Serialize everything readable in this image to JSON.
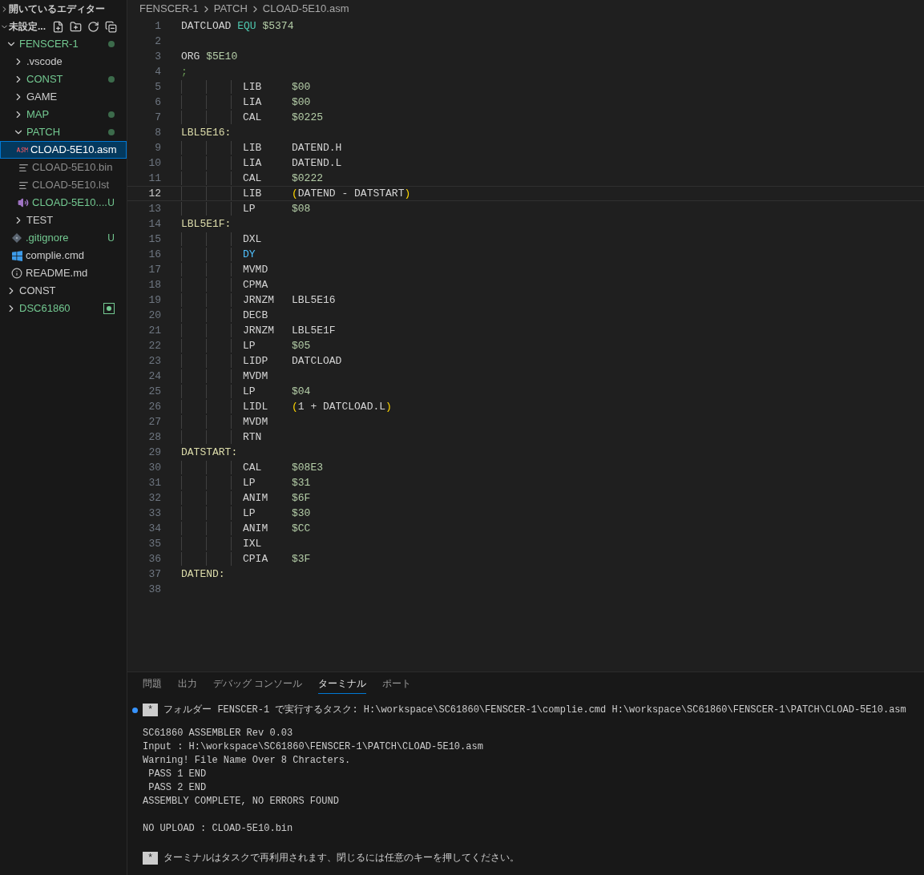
{
  "sidebar": {
    "sections": [
      {
        "title": "開いているエディター",
        "expanded": false
      },
      {
        "title": "未設定...",
        "expanded": true,
        "tree": [
          {
            "label": "FENSCER-1",
            "kind": "folder",
            "expanded": true,
            "selected": false,
            "color": "#73c991",
            "modified": true,
            "children": [
              {
                "label": ".vscode",
                "kind": "folder",
                "expanded": false,
                "selected": false,
                "color": "#cccccc",
                "modified": false
              },
              {
                "label": "CONST",
                "kind": "folder",
                "expanded": false,
                "selected": false,
                "color": "#73c991",
                "modified": true
              },
              {
                "label": "GAME",
                "kind": "folder",
                "expanded": false,
                "selected": false,
                "color": "#cccccc",
                "modified": false
              },
              {
                "label": "MAP",
                "kind": "folder",
                "expanded": false,
                "selected": false,
                "color": "#73c991",
                "modified": true
              },
              {
                "label": "PATCH",
                "kind": "folder",
                "expanded": true,
                "selected": false,
                "color": "#73c991",
                "modified": true,
                "children": [
                  {
                    "label": "CLOAD-5E10.asm",
                    "kind": "asm-file",
                    "selected": true
                  },
                  {
                    "label": "CLOAD-5E10.bin",
                    "kind": "text-file",
                    "selected": false,
                    "color": "#8c8c8c"
                  },
                  {
                    "label": "CLOAD-5E10.lst",
                    "kind": "text-file",
                    "selected": false,
                    "color": "#8c8c8c"
                  },
                  {
                    "label": "CLOAD-5E10....",
                    "kind": "audio-file",
                    "selected": false,
                    "color": "#73c991",
                    "status": "U"
                  }
                ]
              },
              {
                "label": "TEST",
                "kind": "folder",
                "expanded": false,
                "selected": false,
                "color": "#cccccc",
                "modified": false
              },
              {
                "label": ".gitignore",
                "kind": "git-file",
                "selected": false,
                "color": "#73c991",
                "status": "U"
              },
              {
                "label": "complie.cmd",
                "kind": "windows-file",
                "selected": false,
                "color": "#cccccc"
              },
              {
                "label": "README.md",
                "kind": "info-file",
                "selected": false,
                "color": "#cccccc"
              }
            ]
          },
          {
            "label": "CONST",
            "kind": "folder",
            "expanded": false,
            "selected": false,
            "color": "#cccccc",
            "modified": false
          },
          {
            "label": "DSC61860",
            "kind": "repo-folder",
            "expanded": false,
            "selected": false,
            "color": "#73c991",
            "modified": true
          }
        ]
      }
    ]
  },
  "breadcrumbs": [
    "FENSCER-1",
    "PATCH",
    "CLOAD-5E10.asm"
  ],
  "editor": {
    "lines": [
      {
        "n": "1",
        "kind": "plain",
        "current": false,
        "tokens": [
          {
            "text": "DATCLOAD",
            "kind": "plain"
          },
          {
            "text": "EQU",
            "kind": "keyword"
          },
          {
            "text": "$5374",
            "kind": "number"
          }
        ]
      },
      {
        "n": "2",
        "kind": "empty",
        "current": false
      },
      {
        "n": "3",
        "kind": "plain",
        "current": false,
        "tokens": [
          {
            "text": "ORG",
            "kind": "plain"
          },
          {
            "text": "$5E10",
            "kind": "number"
          }
        ]
      },
      {
        "n": "4",
        "kind": "plain",
        "current": false,
        "tokens": [
          {
            "text": ";",
            "kind": "comment"
          }
        ]
      },
      {
        "n": "5",
        "kind": "instruction",
        "current": false,
        "op": {
          "text": "LIB",
          "kind": "plain"
        },
        "operand": [
          {
            "text": "$00",
            "kind": "number"
          }
        ]
      },
      {
        "n": "6",
        "kind": "instruction",
        "current": false,
        "op": {
          "text": "LIA",
          "kind": "plain"
        },
        "operand": [
          {
            "text": "$00",
            "kind": "number"
          }
        ]
      },
      {
        "n": "7",
        "kind": "instruction",
        "current": false,
        "op": {
          "text": "CAL",
          "kind": "plain"
        },
        "operand": [
          {
            "text": "$0225",
            "kind": "number"
          }
        ]
      },
      {
        "n": "8",
        "kind": "plain",
        "current": false,
        "tokens": [
          {
            "text": "LBL5E16:",
            "kind": "label"
          }
        ]
      },
      {
        "n": "9",
        "kind": "instruction",
        "current": false,
        "op": {
          "text": "LIB",
          "kind": "plain"
        },
        "operand": [
          {
            "text": "DATEND.H",
            "kind": "plain"
          }
        ]
      },
      {
        "n": "10",
        "kind": "instruction",
        "current": false,
        "op": {
          "text": "LIA",
          "kind": "plain"
        },
        "operand": [
          {
            "text": "DATEND.L",
            "kind": "plain"
          }
        ]
      },
      {
        "n": "11",
        "kind": "instruction",
        "current": false,
        "op": {
          "text": "CAL",
          "kind": "plain"
        },
        "operand": [
          {
            "text": "$0222",
            "kind": "number"
          }
        ]
      },
      {
        "n": "12",
        "kind": "instruction",
        "current": true,
        "op": {
          "text": "LIB",
          "kind": "plain"
        },
        "operand": [
          {
            "text": "(",
            "kind": "paren"
          },
          {
            "text": "DATEND - DATSTART",
            "kind": "plain"
          },
          {
            "text": ")",
            "kind": "paren"
          }
        ]
      },
      {
        "n": "13",
        "kind": "instruction",
        "current": false,
        "op": {
          "text": "LP",
          "kind": "plain"
        },
        "operand": [
          {
            "text": "$08",
            "kind": "number"
          }
        ]
      },
      {
        "n": "14",
        "kind": "plain",
        "current": false,
        "tokens": [
          {
            "text": "LBL5E1F:",
            "kind": "label"
          }
        ]
      },
      {
        "n": "15",
        "kind": "instruction",
        "current": false,
        "op": {
          "text": "DXL",
          "kind": "plain"
        }
      },
      {
        "n": "16",
        "kind": "instruction",
        "current": false,
        "op": {
          "text": "DY",
          "kind": "register"
        }
      },
      {
        "n": "17",
        "kind": "instruction",
        "current": false,
        "op": {
          "text": "MVMD",
          "kind": "plain"
        }
      },
      {
        "n": "18",
        "kind": "instruction",
        "current": false,
        "op": {
          "text": "CPMA",
          "kind": "plain"
        }
      },
      {
        "n": "19",
        "kind": "instruction",
        "current": false,
        "op": {
          "text": "JRNZM",
          "kind": "plain"
        },
        "operand": [
          {
            "text": "LBL5E16",
            "kind": "plain"
          }
        ]
      },
      {
        "n": "20",
        "kind": "instruction",
        "current": false,
        "op": {
          "text": "DECB",
          "kind": "plain"
        }
      },
      {
        "n": "21",
        "kind": "instruction",
        "current": false,
        "op": {
          "text": "JRNZM",
          "kind": "plain"
        },
        "operand": [
          {
            "text": "LBL5E1F",
            "kind": "plain"
          }
        ]
      },
      {
        "n": "22",
        "kind": "instruction",
        "current": false,
        "op": {
          "text": "LP",
          "kind": "plain"
        },
        "operand": [
          {
            "text": "$05",
            "kind": "number"
          }
        ]
      },
      {
        "n": "23",
        "kind": "instruction",
        "current": false,
        "op": {
          "text": "LIDP",
          "kind": "plain"
        },
        "operand": [
          {
            "text": "DATCLOAD",
            "kind": "plain"
          }
        ]
      },
      {
        "n": "24",
        "kind": "instruction",
        "current": false,
        "op": {
          "text": "MVDM",
          "kind": "plain"
        }
      },
      {
        "n": "25",
        "kind": "instruction",
        "current": false,
        "op": {
          "text": "LP",
          "kind": "plain"
        },
        "operand": [
          {
            "text": "$04",
            "kind": "number"
          }
        ]
      },
      {
        "n": "26",
        "kind": "instruction",
        "current": false,
        "op": {
          "text": "LIDL",
          "kind": "plain"
        },
        "operand": [
          {
            "text": "(",
            "kind": "paren"
          },
          {
            "text": "1 + DATCLOAD.L",
            "kind": "plain"
          },
          {
            "text": ")",
            "kind": "paren"
          }
        ]
      },
      {
        "n": "27",
        "kind": "instruction",
        "current": false,
        "op": {
          "text": "MVDM",
          "kind": "plain"
        }
      },
      {
        "n": "28",
        "kind": "instruction",
        "current": false,
        "op": {
          "text": "RTN",
          "kind": "plain"
        }
      },
      {
        "n": "29",
        "kind": "plain",
        "current": false,
        "tokens": [
          {
            "text": "DATSTART:",
            "kind": "label"
          }
        ]
      },
      {
        "n": "30",
        "kind": "instruction",
        "current": false,
        "op": {
          "text": "CAL",
          "kind": "plain"
        },
        "operand": [
          {
            "text": "$08E3",
            "kind": "number"
          }
        ]
      },
      {
        "n": "31",
        "kind": "instruction",
        "current": false,
        "op": {
          "text": "LP",
          "kind": "plain"
        },
        "operand": [
          {
            "text": "$31",
            "kind": "number"
          }
        ]
      },
      {
        "n": "32",
        "kind": "instruction",
        "current": false,
        "op": {
          "text": "ANIM",
          "kind": "plain"
        },
        "operand": [
          {
            "text": "$6F",
            "kind": "number"
          }
        ]
      },
      {
        "n": "33",
        "kind": "instruction",
        "current": false,
        "op": {
          "text": "LP",
          "kind": "plain"
        },
        "operand": [
          {
            "text": "$30",
            "kind": "number"
          }
        ]
      },
      {
        "n": "34",
        "kind": "instruction",
        "current": false,
        "op": {
          "text": "ANIM",
          "kind": "plain"
        },
        "operand": [
          {
            "text": "$CC",
            "kind": "number"
          }
        ]
      },
      {
        "n": "35",
        "kind": "instruction",
        "current": false,
        "op": {
          "text": "IXL",
          "kind": "plain"
        }
      },
      {
        "n": "36",
        "kind": "instruction",
        "current": false,
        "op": {
          "text": "CPIA",
          "kind": "plain"
        },
        "operand": [
          {
            "text": "$3F",
            "kind": "number"
          }
        ]
      },
      {
        "n": "37",
        "kind": "plain",
        "current": false,
        "tokens": [
          {
            "text": "DATEND:",
            "kind": "label"
          }
        ]
      },
      {
        "n": "38",
        "kind": "empty",
        "current": false
      }
    ]
  },
  "panel": {
    "tabs": [
      {
        "label": "問題",
        "selected": false
      },
      {
        "label": "出力",
        "selected": false
      },
      {
        "label": "デバッグ コンソール",
        "selected": false
      },
      {
        "label": "ターミナル",
        "selected": true
      },
      {
        "label": "ポート",
        "selected": false
      }
    ],
    "terminal": [
      {
        "kind": "task",
        "badge": "*",
        "text": "フォルダー FENSCER-1 で実行するタスク: H:\\workspace\\SC61860\\FENSCER-1\\complie.cmd H:\\workspace\\SC61860\\FENSCER-1\\PATCH\\CLOAD-5E10.asm"
      },
      {
        "kind": "output",
        "lines": [
          "SC61860 ASSEMBLER Rev 0.03",
          "Input : H:\\workspace\\SC61860\\FENSCER-1\\PATCH\\CLOAD-5E10.asm",
          "Warning! File Name Over 8 Chracters.",
          " PASS 1 END",
          " PASS 2 END",
          "ASSEMBLY COMPLETE, NO ERRORS FOUND"
        ]
      },
      {
        "kind": "output",
        "lines": [
          "NO UPLOAD : CLOAD-5E10.bin"
        ]
      },
      {
        "kind": "notice",
        "badge": "*",
        "text": "ターミナルはタスクで再利用されます、閉じるには任意のキーを押してください。"
      }
    ]
  }
}
